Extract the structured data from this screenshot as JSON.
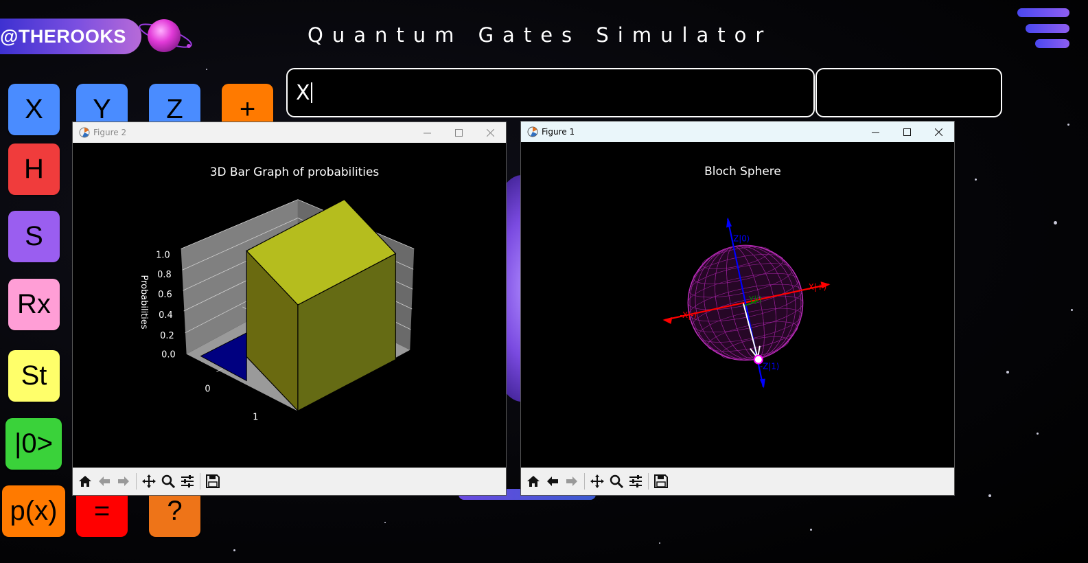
{
  "brand": {
    "handle": "@THEROOKS"
  },
  "page": {
    "title": "Quantum Gates Simulator"
  },
  "expression": {
    "value": "X",
    "result": ""
  },
  "gates": [
    {
      "label": "X",
      "color": "#4a8cff"
    },
    {
      "label": "Y",
      "color": "#4a8cff"
    },
    {
      "label": "Z",
      "color": "#4a8cff"
    },
    {
      "label": "+",
      "color": "#ff7a00"
    },
    {
      "label": "H",
      "color": "#f03c3c"
    },
    {
      "label": "S",
      "color": "#9a5ef0"
    },
    {
      "label": "Rx",
      "color": "#ff9ed6"
    },
    {
      "label": "St",
      "color": "#ffff6a"
    },
    {
      "label": "|0>",
      "color": "#3ad23a"
    },
    {
      "label": "p(x)",
      "color": "#ff7a00"
    },
    {
      "label": "=",
      "color": "#ff0000"
    },
    {
      "label": "?",
      "color": "#ee7418"
    }
  ],
  "figure2": {
    "window_title": "Figure 2",
    "plot_title": "3D Bar Graph of probabilities",
    "zlabel": "Probabilities",
    "z_ticks": [
      "0.0",
      "0.2",
      "0.4",
      "0.6",
      "0.8",
      "1.0"
    ],
    "x_ticks": [
      "0",
      "1"
    ],
    "chart_data": {
      "type": "bar",
      "title": "3D Bar Graph of probabilities",
      "categories": [
        "0",
        "1"
      ],
      "values": [
        0.0,
        1.0
      ],
      "colors": [
        "#000080",
        "#b5bd1e"
      ],
      "zlabel": "Probabilities",
      "zlim": [
        0,
        1.0
      ]
    }
  },
  "figure1": {
    "window_title": "Figure 1",
    "plot_title": "Bloch Sphere",
    "labels": {
      "z_pos": "Z|0⟩",
      "z_neg": "-Z|1⟩",
      "x_pos": "X|+⟩",
      "x_neg": "-X|-⟩",
      "y_pos": "Y|i⟩"
    }
  },
  "toolbar_icons": [
    "home-icon",
    "back-icon",
    "forward-icon",
    "pan-icon",
    "zoom-icon",
    "configure-icon",
    "save-icon"
  ]
}
